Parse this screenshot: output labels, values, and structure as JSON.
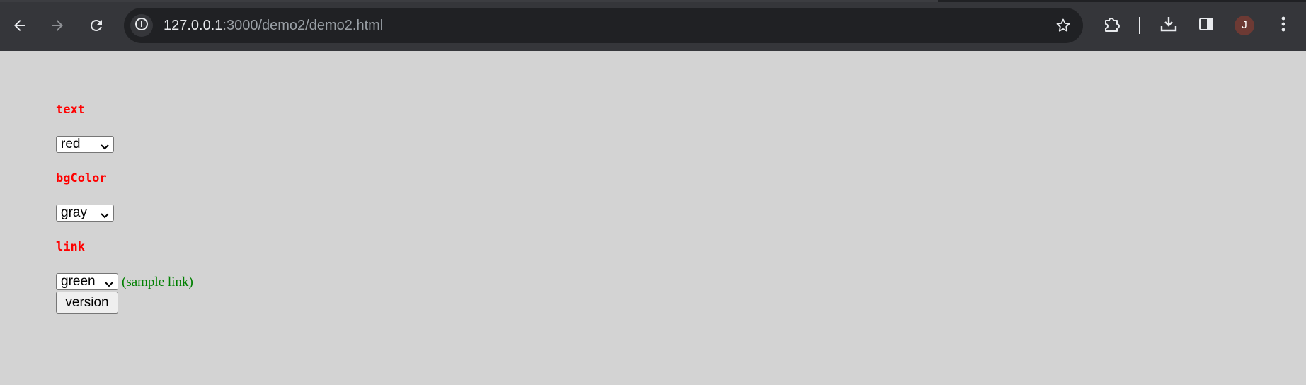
{
  "browser": {
    "url_host": "127.0.0.1",
    "url_rest": ":3000/demo2/demo2.html",
    "profile_initial": "J",
    "icons": {
      "back": "back-arrow-icon",
      "forward": "forward-arrow-icon",
      "reload": "reload-icon",
      "site_info": "info-icon",
      "bookmark": "star-icon",
      "extensions": "puzzle-icon",
      "downloads": "download-icon",
      "side_panel": "side-panel-icon",
      "menu": "kebab-menu-icon"
    }
  },
  "page": {
    "text_label": "text",
    "text_select_value": "red",
    "bgcolor_label": "bgColor",
    "bgcolor_select_value": "gray",
    "link_label": "link",
    "link_select_value": "green",
    "sample_link_text": "(sample link)",
    "version_button_label": "version"
  },
  "colors": {
    "background": "#d3d3d3",
    "label_text": "#ff0000",
    "link": "#008000"
  }
}
